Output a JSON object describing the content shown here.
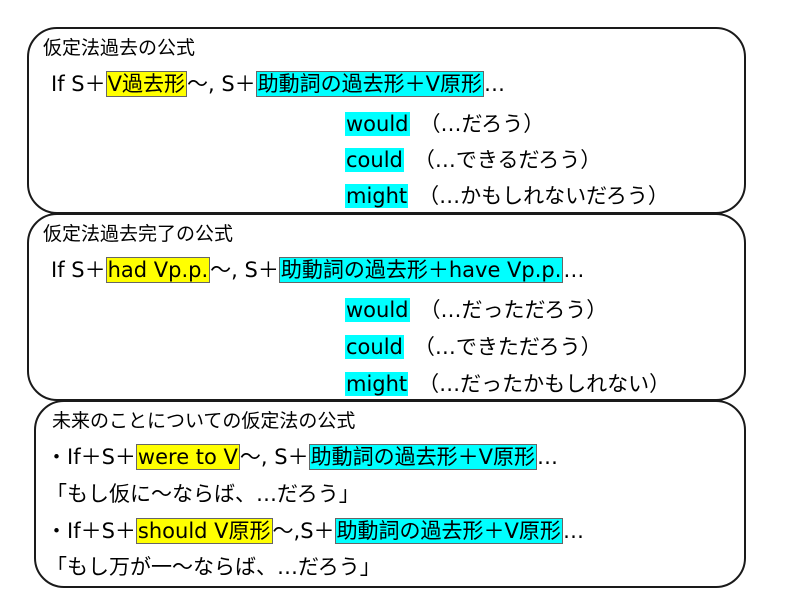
{
  "section1": {
    "title": "仮定法過去の公式",
    "formula": {
      "prefix": "If S＋",
      "condition": "V過去形",
      "middle": "～, S＋",
      "result": "助動詞の過去形＋V原形",
      "suffix": "…"
    },
    "modals": [
      {
        "word": "would",
        "meaning": "（…だろう）"
      },
      {
        "word": "could",
        "meaning": "（…できるだろう）"
      },
      {
        "word": "might",
        "meaning": "（…かもしれないだろう）"
      }
    ]
  },
  "section2": {
    "title": "仮定法過去完了の公式",
    "formula": {
      "prefix": "If S＋",
      "condition": "had Vp.p.",
      "middle": "～, S＋",
      "result": "助動詞の過去形＋have Vp.p.",
      "suffix": "…"
    },
    "modals": [
      {
        "word": "would",
        "meaning": "（…だっただろう）"
      },
      {
        "word": "could",
        "meaning": "（…できただろう）"
      },
      {
        "word": "might",
        "meaning": "（…だったかもしれない）"
      }
    ]
  },
  "section3": {
    "title": "未来のことについての仮定法の公式",
    "items": [
      {
        "prefix": "・If＋S＋",
        "condition": "were to V",
        "middle": "～, S＋",
        "result": "助動詞の過去形＋V原形",
        "suffix": "…",
        "translation": "「もし仮に～ならば、…だろう」"
      },
      {
        "prefix": "・If＋S＋",
        "condition": "should V原形",
        "middle": "～,S＋",
        "result": "助動詞の過去形＋V原形",
        "suffix": "…",
        "translation": "「もし万が一～ならば、…だろう」"
      }
    ]
  },
  "colors": {
    "condition_highlight": "#ffff00",
    "result_highlight": "#00ffff",
    "border": "#1a1a1a"
  }
}
